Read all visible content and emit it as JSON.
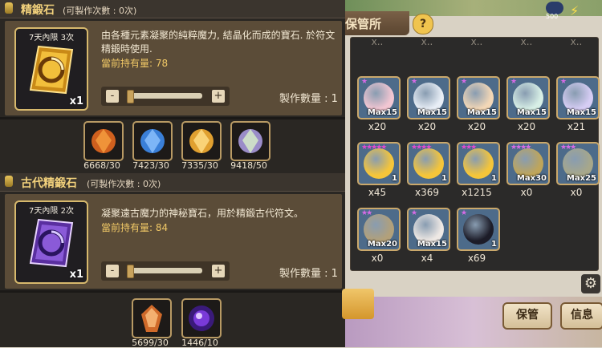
{
  "sections": [
    {
      "title": "精鍛石",
      "craft_count_label": "(可製作次數 : 0次)",
      "limit_label": "7天內限 3次",
      "qty_badge": "x1",
      "description": "由各種元素凝聚的純粹魔力, 結晶化而成的寶石. 於符文精鍛時使用.",
      "owned": "當前持有量: 78",
      "craft_qty": "製作數量 : 1",
      "minus": "-",
      "plus": "+",
      "gem_color": "#e0a62b",
      "materials": [
        {
          "label": "6668/30",
          "color": "#d0601e",
          "icon": "fire-essence-icon"
        },
        {
          "label": "7423/30",
          "color": "#3a7fd8",
          "icon": "water-essence-icon"
        },
        {
          "label": "7335/30",
          "color": "#e0a030",
          "icon": "wind-essence-icon"
        },
        {
          "label": "9418/50",
          "color": "#9a8cc8",
          "icon": "magic-essence-icon"
        }
      ]
    },
    {
      "title": "古代精鍛石",
      "craft_count_label": "(可製作次數 : 0次)",
      "limit_label": "7天內限 2次",
      "qty_badge": "x1",
      "description": "凝聚遠古魔力的神秘寶石，用於精鍛古代符文。",
      "owned": "當前持有量: 84",
      "craft_qty": "製作數量 : 1",
      "minus": "-",
      "plus": "+",
      "gem_color": "#8a5ad8",
      "materials": [
        {
          "label": "5699/30",
          "color": "#d06a2a",
          "icon": "ancient-crystal-icon"
        },
        {
          "label": "1446/10",
          "color": "#7a3ad8",
          "icon": "dark-orb-icon"
        }
      ]
    }
  ],
  "storage": {
    "title": "保管所",
    "help": "?",
    "top_counter": "500",
    "settings": "⚙",
    "bottom_buttons": [
      "保管",
      "信息"
    ],
    "partial_counts": [
      "x..",
      "x..",
      "x..",
      "x..",
      "x.."
    ],
    "monsters": [
      {
        "max": "Max15",
        "count": "x20",
        "stars": "★",
        "color": "#f2c6d2"
      },
      {
        "max": "Max15",
        "count": "x20",
        "stars": "★",
        "color": "#e8eef6"
      },
      {
        "max": "Max15",
        "count": "x20",
        "stars": "★",
        "color": "#f3d7b6"
      },
      {
        "max": "Max15",
        "count": "x20",
        "stars": "★",
        "color": "#d7efe6"
      },
      {
        "max": "Max15",
        "count": "x21",
        "stars": "★",
        "color": "#d6cdf4"
      },
      {
        "max": "1",
        "count": "x45",
        "stars": "★★★★★",
        "color": "#f5c53a"
      },
      {
        "max": "1",
        "count": "x369",
        "stars": "★★★★",
        "color": "#f5c53a"
      },
      {
        "max": "1",
        "count": "x1215",
        "stars": "★★★",
        "color": "#f5c53a"
      },
      {
        "max": "Max30",
        "count": "x0",
        "stars": "★★★★",
        "color": "#bfa55a"
      },
      {
        "max": "Max25",
        "count": "x0",
        "stars": "★★★",
        "color": "#a7a78a"
      },
      {
        "max": "Max20",
        "count": "x0",
        "stars": "★★",
        "color": "#b2a07a"
      },
      {
        "max": "Max15",
        "count": "x4",
        "stars": "★",
        "color": "#eee8e4"
      },
      {
        "max": "1",
        "count": "x69",
        "stars": "★",
        "color": "#1c1c28"
      }
    ]
  }
}
